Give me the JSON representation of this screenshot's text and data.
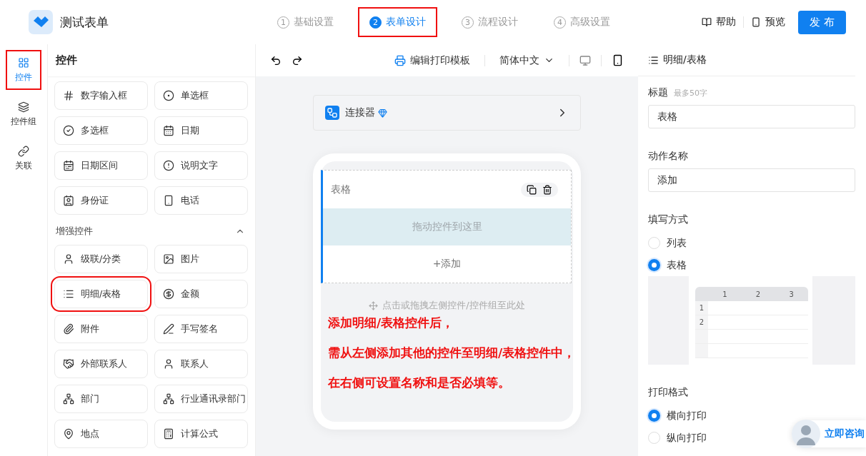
{
  "header": {
    "app_name": "测试表单",
    "steps": [
      {
        "number": "1",
        "label": "基础设置",
        "selected": false,
        "annotated": false
      },
      {
        "number": "2",
        "label": "表单设计",
        "selected": true,
        "annotated": true
      },
      {
        "number": "3",
        "label": "流程设计",
        "selected": false,
        "annotated": false
      },
      {
        "number": "4",
        "label": "高级设置",
        "selected": false,
        "annotated": false
      }
    ],
    "help": "帮助",
    "preview": "预览",
    "publish": "发 布"
  },
  "rail": [
    {
      "kind": "grid",
      "label": "控件",
      "selected": true,
      "annotated": true
    },
    {
      "kind": "layers",
      "label": "控件组",
      "selected": false,
      "annotated": false
    },
    {
      "kind": "link",
      "label": "关联",
      "selected": false,
      "annotated": false
    }
  ],
  "controls_panel": {
    "title": "控件",
    "basic": [
      {
        "kind": "number",
        "label": "数字输入框",
        "annotated": false
      },
      {
        "kind": "radio",
        "label": "单选框",
        "annotated": false
      },
      {
        "kind": "checkbox",
        "label": "多选框",
        "annotated": false
      },
      {
        "kind": "date",
        "label": "日期",
        "annotated": false
      },
      {
        "kind": "daterange",
        "label": "日期区间",
        "annotated": false
      },
      {
        "kind": "info",
        "label": "说明文字",
        "annotated": false
      },
      {
        "kind": "idcard",
        "label": "身份证",
        "annotated": false
      },
      {
        "kind": "phone",
        "label": "电话",
        "annotated": false
      }
    ],
    "section": {
      "title": "增强控件",
      "expanded": true
    },
    "enhanced": [
      {
        "kind": "person",
        "label": "级联/分类",
        "annotated": false
      },
      {
        "kind": "image",
        "label": "图片",
        "annotated": false
      },
      {
        "kind": "list",
        "label": "明细/表格",
        "annotated": true
      },
      {
        "kind": "money",
        "label": "金额",
        "annotated": false
      },
      {
        "kind": "attachment",
        "label": "附件",
        "annotated": false
      },
      {
        "kind": "signature",
        "label": "手写签名",
        "annotated": false
      },
      {
        "kind": "handshake",
        "label": "外部联系人",
        "annotated": false
      },
      {
        "kind": "person",
        "label": "联系人",
        "annotated": false
      },
      {
        "kind": "org",
        "label": "部门",
        "annotated": false
      },
      {
        "kind": "org",
        "label": "行业通讯录部门",
        "annotated": false
      },
      {
        "kind": "location",
        "label": "地点",
        "annotated": false
      },
      {
        "kind": "formula",
        "label": "计算公式",
        "annotated": false
      }
    ]
  },
  "toolbar": {
    "print_template": "编辑打印模板",
    "language": "简体中文"
  },
  "canvas": {
    "connector": {
      "label": "连接器",
      "premium": true
    },
    "table_field": {
      "title": "表格",
      "selected": true,
      "drop_hint": "拖动控件到这里",
      "add": "+添加"
    },
    "drop_hint": "点击或拖拽左侧控件/控件组至此处",
    "annotation_lines": [
      "添加明细/表格控件后，",
      "需从左侧添加其他的控件至明细/表格控件中，",
      "在右侧可设置名称和是否必填等。"
    ]
  },
  "properties": {
    "title": "明细/表格",
    "title_field": {
      "label": "标题",
      "hint": "最多50字",
      "value": "表格"
    },
    "action_field": {
      "label": "动作名称",
      "value": "添加"
    },
    "fill_mode": {
      "label": "填写方式",
      "options": [
        {
          "label": "列表",
          "selected": false
        },
        {
          "label": "表格",
          "selected": true
        }
      ],
      "preview": {
        "columns": [
          "1",
          "2",
          "3"
        ],
        "rows": [
          "1",
          "2"
        ]
      }
    },
    "print_format": {
      "label": "打印格式",
      "options": [
        {
          "label": "横向打印",
          "selected": true
        },
        {
          "label": "纵向打印",
          "selected": false
        }
      ]
    }
  },
  "consult": {
    "label": "立即咨询"
  }
}
